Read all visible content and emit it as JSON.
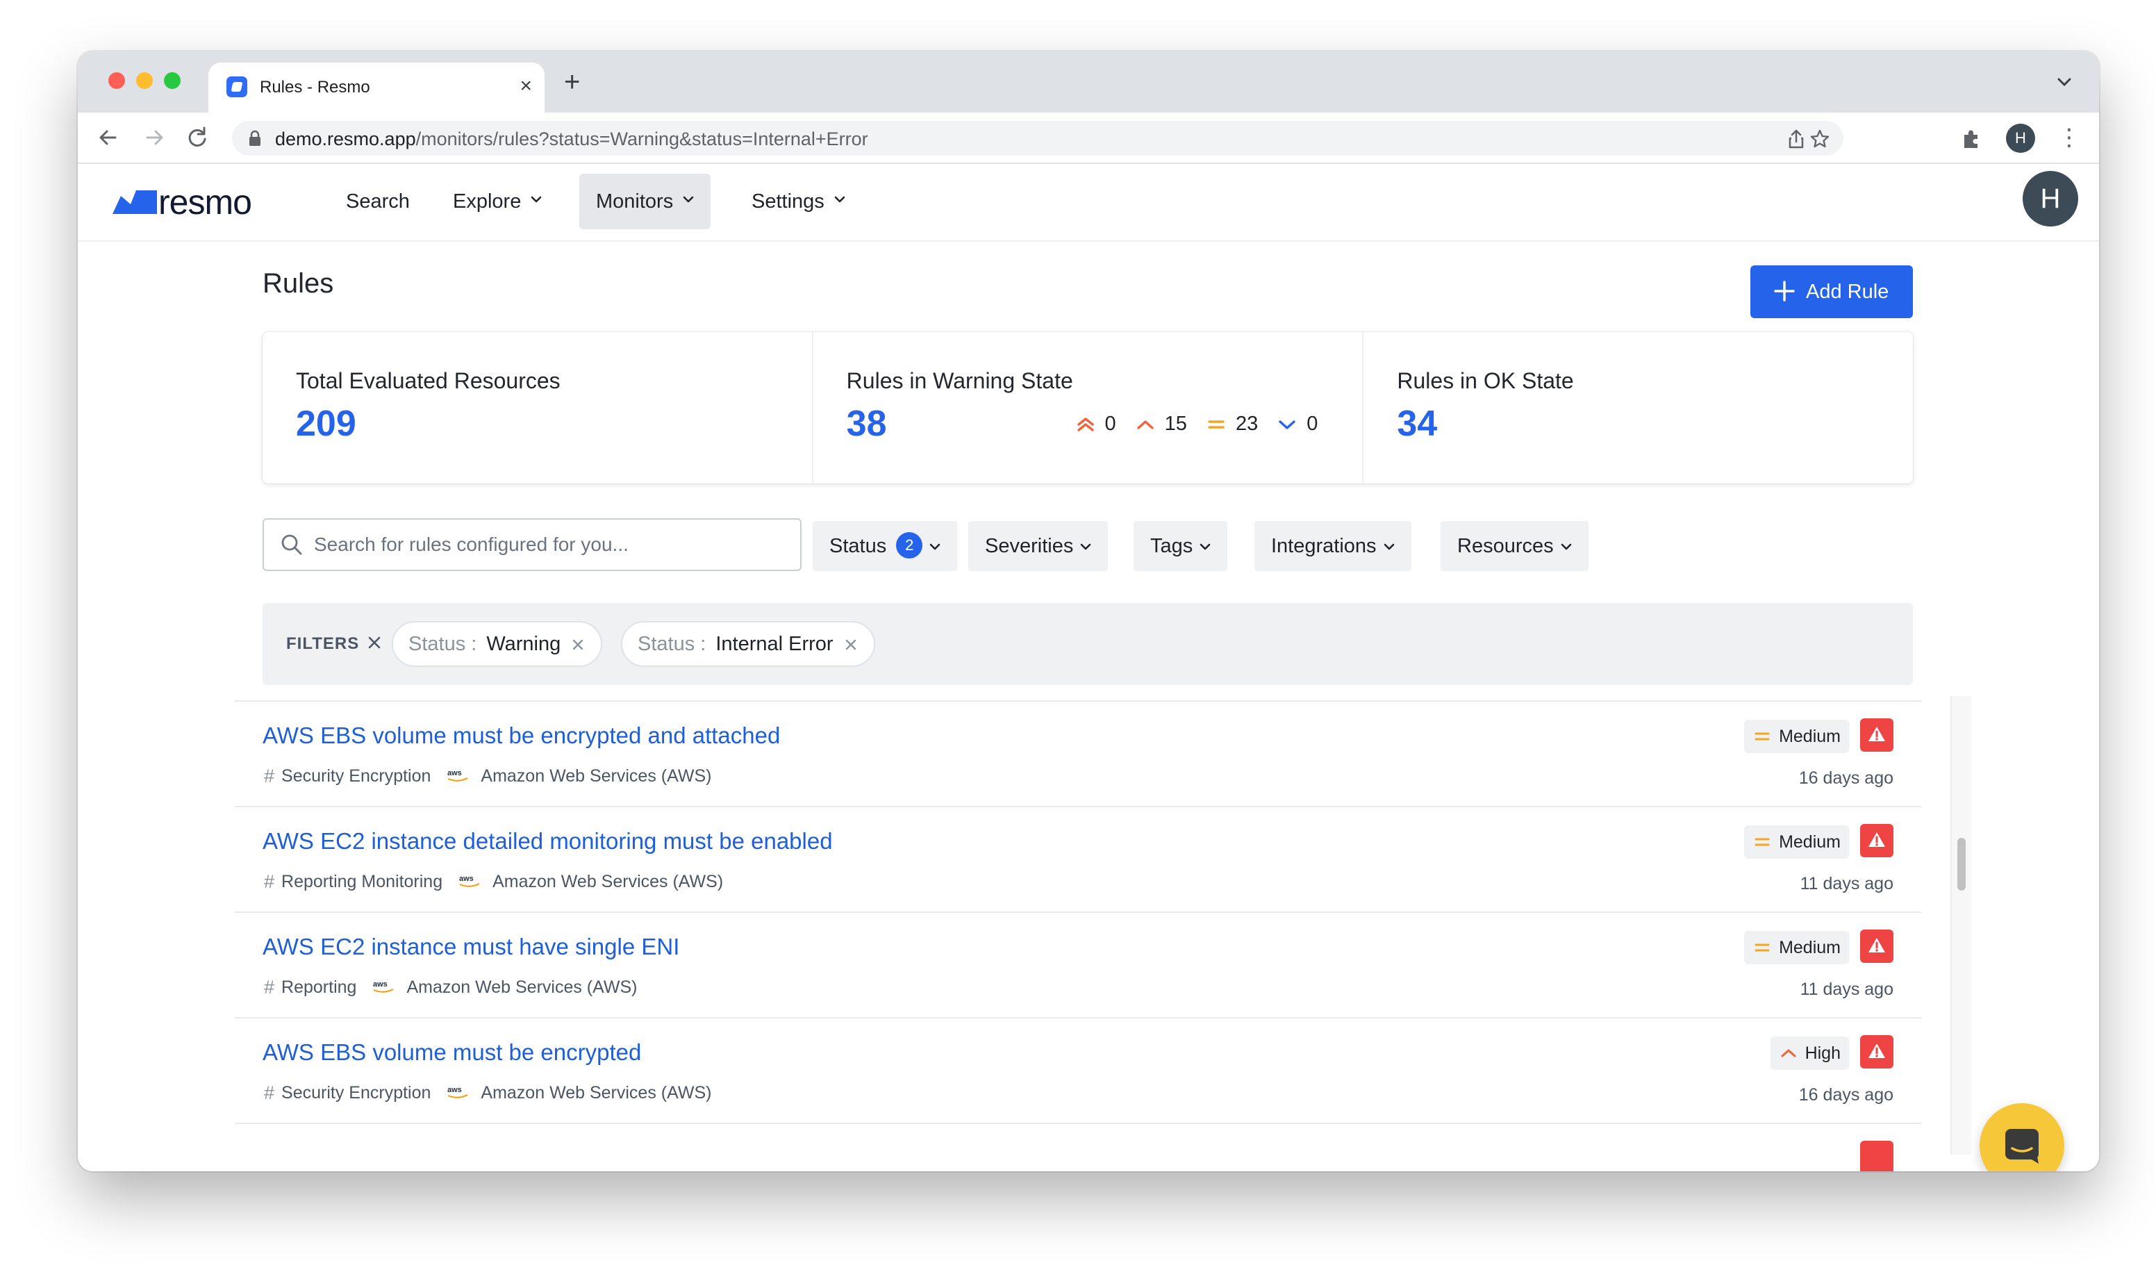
{
  "browser": {
    "tab_title": "Rules - Resmo",
    "url_host": "demo.resmo.app",
    "url_path": "/monitors/rules?status=Warning&status=Internal+Error",
    "profile_initial": "H"
  },
  "nav": {
    "logo_text": "resmo",
    "items": [
      {
        "label": "Search",
        "has_menu": false
      },
      {
        "label": "Explore",
        "has_menu": true
      },
      {
        "label": "Monitors",
        "has_menu": true,
        "active": true
      },
      {
        "label": "Settings",
        "has_menu": true
      }
    ],
    "avatar_initial": "H"
  },
  "page": {
    "title": "Rules",
    "add_button": "Add Rule"
  },
  "stats": [
    {
      "label": "Total Evaluated Resources",
      "value": "209"
    },
    {
      "label": "Rules in Warning State",
      "value": "38",
      "breakdown": [
        {
          "severity": "critical",
          "count": "0"
        },
        {
          "severity": "high",
          "count": "15"
        },
        {
          "severity": "medium",
          "count": "23"
        },
        {
          "severity": "low",
          "count": "0"
        }
      ]
    },
    {
      "label": "Rules in OK State",
      "value": "34"
    }
  ],
  "filters": {
    "search_placeholder": "Search for rules configured for you...",
    "buttons": [
      {
        "label": "Status",
        "badge": "2"
      },
      {
        "label": "Severities"
      },
      {
        "label": "Tags"
      },
      {
        "label": "Integrations"
      },
      {
        "label": "Resources"
      }
    ],
    "active_label": "FILTERS",
    "chips": [
      {
        "key": "Status :",
        "value": "Warning"
      },
      {
        "key": "Status :",
        "value": "Internal Error"
      }
    ]
  },
  "rules": [
    {
      "title": "AWS EBS volume must be encrypted and attached",
      "tags": "Security Encryption",
      "integration": "Amazon Web Services (AWS)",
      "severity": "Medium",
      "time": "16 days ago"
    },
    {
      "title": "AWS EC2 instance detailed monitoring must be enabled",
      "tags": "Reporting Monitoring",
      "integration": "Amazon Web Services (AWS)",
      "severity": "Medium",
      "time": "11 days ago"
    },
    {
      "title": "AWS EC2 instance must have single ENI",
      "tags": "Reporting",
      "integration": "Amazon Web Services (AWS)",
      "severity": "Medium",
      "time": "11 days ago"
    },
    {
      "title": "AWS EBS volume must be encrypted",
      "tags": "Security Encryption",
      "integration": "Amazon Web Services (AWS)",
      "severity": "High",
      "time": "16 days ago"
    }
  ],
  "colors": {
    "accent": "#2563eb",
    "critical": "#ef4444",
    "high": "#f0643c",
    "medium": "#f5a524",
    "low": "#2563eb",
    "chat": "#f7c73a"
  }
}
